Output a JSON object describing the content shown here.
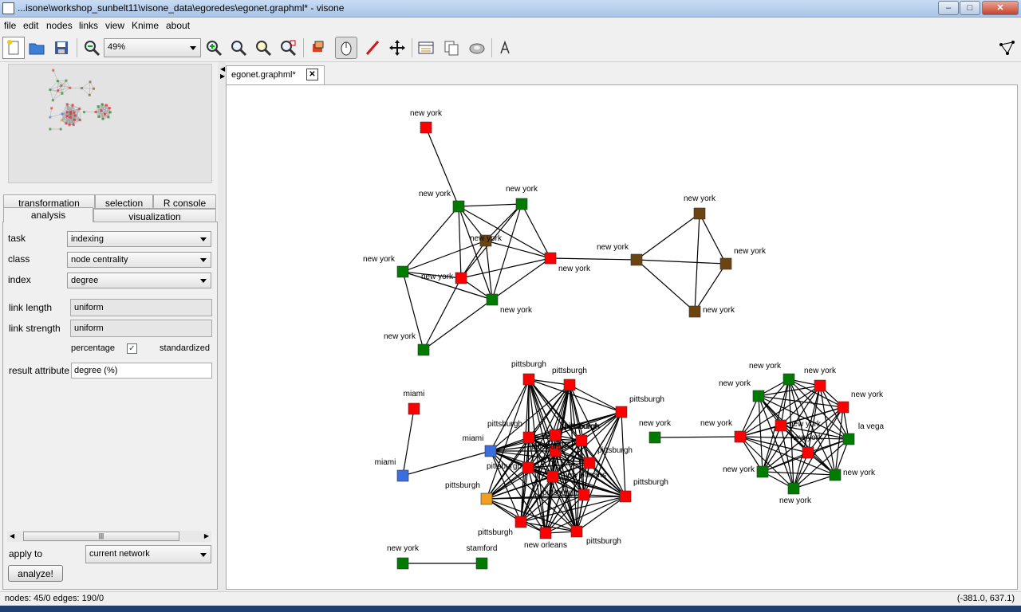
{
  "window": {
    "title": "...isone\\workshop_sunbelt11\\visone_data\\egoredes\\egonet.graphml* - visone",
    "min_label": "–",
    "max_label": "□",
    "close_label": "✕"
  },
  "menu": [
    "file",
    "edit",
    "nodes",
    "links",
    "view",
    "Knime",
    "about"
  ],
  "toolbar": {
    "zoom": "49%"
  },
  "tabs": {
    "transformation": "transformation",
    "selection": "selection",
    "r_console": "R console",
    "analysis": "analysis",
    "visualization": "visualization"
  },
  "panel": {
    "task_label": "task",
    "task_value": "indexing",
    "class_label": "class",
    "class_value": "node centrality",
    "index_label": "index",
    "index_value": "degree",
    "link_length_label": "link length",
    "link_length_value": "uniform",
    "link_strength_label": "link strength",
    "link_strength_value": "uniform",
    "percentage_label": "percentage",
    "percentage_checked": true,
    "check_glyph": "✓",
    "standardized_label": "standardized",
    "result_attribute_label": "result attribute",
    "result_attribute_value": "degree (%)",
    "apply_to_label": "apply to",
    "apply_to_value": "current network",
    "analyze_button": "analyze!"
  },
  "document_tab": {
    "label": "egonet.graphml*",
    "close": "✕"
  },
  "status": {
    "left": "nodes: 45/0  edges: 190/0",
    "right": "(-381.0, 637.1)"
  },
  "colors": {
    "red": "#ff0000",
    "green": "#007a00",
    "brown": "#6b4412",
    "blue": "#3b6fe0",
    "orange": "#f0a020"
  },
  "graph": {
    "nodes": [
      {
        "id": "a1",
        "c": "red",
        "label": "new york"
      },
      {
        "id": "a2",
        "c": "green",
        "label": "new york"
      },
      {
        "id": "a3",
        "c": "green",
        "label": "new york"
      },
      {
        "id": "a4",
        "c": "brown",
        "label": "new york"
      },
      {
        "id": "a5",
        "c": "red",
        "label": "new york"
      },
      {
        "id": "a6",
        "c": "green",
        "label": "new york"
      },
      {
        "id": "a7",
        "c": "red",
        "label": "new york"
      },
      {
        "id": "a8",
        "c": "green",
        "label": "new york"
      },
      {
        "id": "a9",
        "c": "green",
        "label": "new york"
      },
      {
        "id": "b1",
        "c": "brown",
        "label": "new york"
      },
      {
        "id": "b2",
        "c": "brown",
        "label": "new york"
      },
      {
        "id": "b3",
        "c": "brown",
        "label": "new york"
      },
      {
        "id": "b4",
        "c": "brown",
        "label": "new york"
      },
      {
        "id": "c1",
        "c": "red",
        "label": "miami"
      },
      {
        "id": "c2",
        "c": "blue",
        "label": "miami"
      },
      {
        "id": "c3",
        "c": "blue",
        "label": "miami"
      },
      {
        "id": "c4",
        "c": "orange",
        "label": "pittsburgh"
      },
      {
        "id": "p1",
        "c": "red",
        "label": "pittsburgh"
      },
      {
        "id": "p2",
        "c": "red",
        "label": "pittsburgh"
      },
      {
        "id": "p3",
        "c": "red",
        "label": "pittsburgh"
      },
      {
        "id": "p4",
        "c": "red",
        "label": "pittsburgh"
      },
      {
        "id": "p5",
        "c": "red",
        "label": "pittsburgh"
      },
      {
        "id": "p6",
        "c": "red",
        "label": "pittsburgh"
      },
      {
        "id": "p7",
        "c": "red",
        "label": "pittsburgh"
      },
      {
        "id": "p8",
        "c": "red",
        "label": "pittsburgh"
      },
      {
        "id": "p9",
        "c": "red",
        "label": "new orleans"
      },
      {
        "id": "p10",
        "c": "red",
        "label": "pittsburgh"
      },
      {
        "id": "p11",
        "c": "red",
        "label": "pittsburgh"
      },
      {
        "id": "p12",
        "c": "red",
        "label": "pittsburgh"
      },
      {
        "id": "p13",
        "c": "red",
        "label": "new orleans"
      },
      {
        "id": "p14",
        "c": "red",
        "label": "pittsburgh"
      },
      {
        "id": "p15",
        "c": "red",
        "label": "pittsburgh"
      },
      {
        "id": "d1",
        "c": "green",
        "label": "new york"
      },
      {
        "id": "d2",
        "c": "green",
        "label": "stamford"
      },
      {
        "id": "e0",
        "c": "green",
        "label": "new york"
      },
      {
        "id": "e1",
        "c": "red",
        "label": "new york"
      },
      {
        "id": "e2",
        "c": "green",
        "label": "new york"
      },
      {
        "id": "e3",
        "c": "green",
        "label": "new york"
      },
      {
        "id": "e4",
        "c": "red",
        "label": "new york"
      },
      {
        "id": "e5",
        "c": "red",
        "label": "new york"
      },
      {
        "id": "e6",
        "c": "green",
        "label": "la vega"
      },
      {
        "id": "e7",
        "c": "red",
        "label": "new york"
      },
      {
        "id": "e8",
        "c": "red",
        "label": "new york"
      },
      {
        "id": "e9",
        "c": "green",
        "label": "new york"
      },
      {
        "id": "e10",
        "c": "green",
        "label": "new york"
      },
      {
        "id": "e11",
        "c": "green",
        "label": "new york"
      }
    ]
  }
}
